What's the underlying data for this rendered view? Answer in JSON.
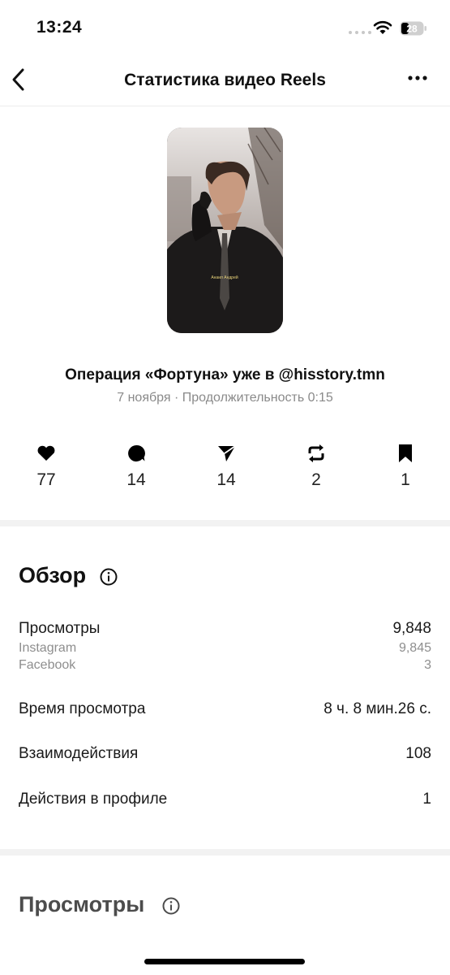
{
  "status_bar": {
    "time": "13:24",
    "battery": "28"
  },
  "nav": {
    "title": "Статистика видео Reels"
  },
  "video": {
    "title": "Операция «Фортуна» уже в @hisstory.tmn",
    "meta": "7 ноября · Продолжительность 0:15",
    "thumbnail_caption": "Анаил Андрей"
  },
  "stats": {
    "likes": "77",
    "comments": "14",
    "shares": "14",
    "reposts": "2",
    "saves": "1"
  },
  "overview": {
    "title": "Обзор",
    "views_label": "Просмотры",
    "views_value": "9,848",
    "instagram_label": "Instagram",
    "instagram_value": "9,845",
    "facebook_label": "Facebook",
    "facebook_value": "3",
    "watch_time_label": "Время просмотра",
    "watch_time_value": "8 ч. 8 мин.26 с.",
    "interactions_label": "Взаимодействия",
    "interactions_value": "108",
    "profile_actions_label": "Действия в профиле",
    "profile_actions_value": "1"
  },
  "views_section": {
    "title": "Просмотры"
  },
  "icons": [
    "back-icon",
    "more-icon",
    "heart-icon",
    "comment-icon",
    "send-icon",
    "repost-icon",
    "bookmark-icon",
    "info-icon"
  ]
}
